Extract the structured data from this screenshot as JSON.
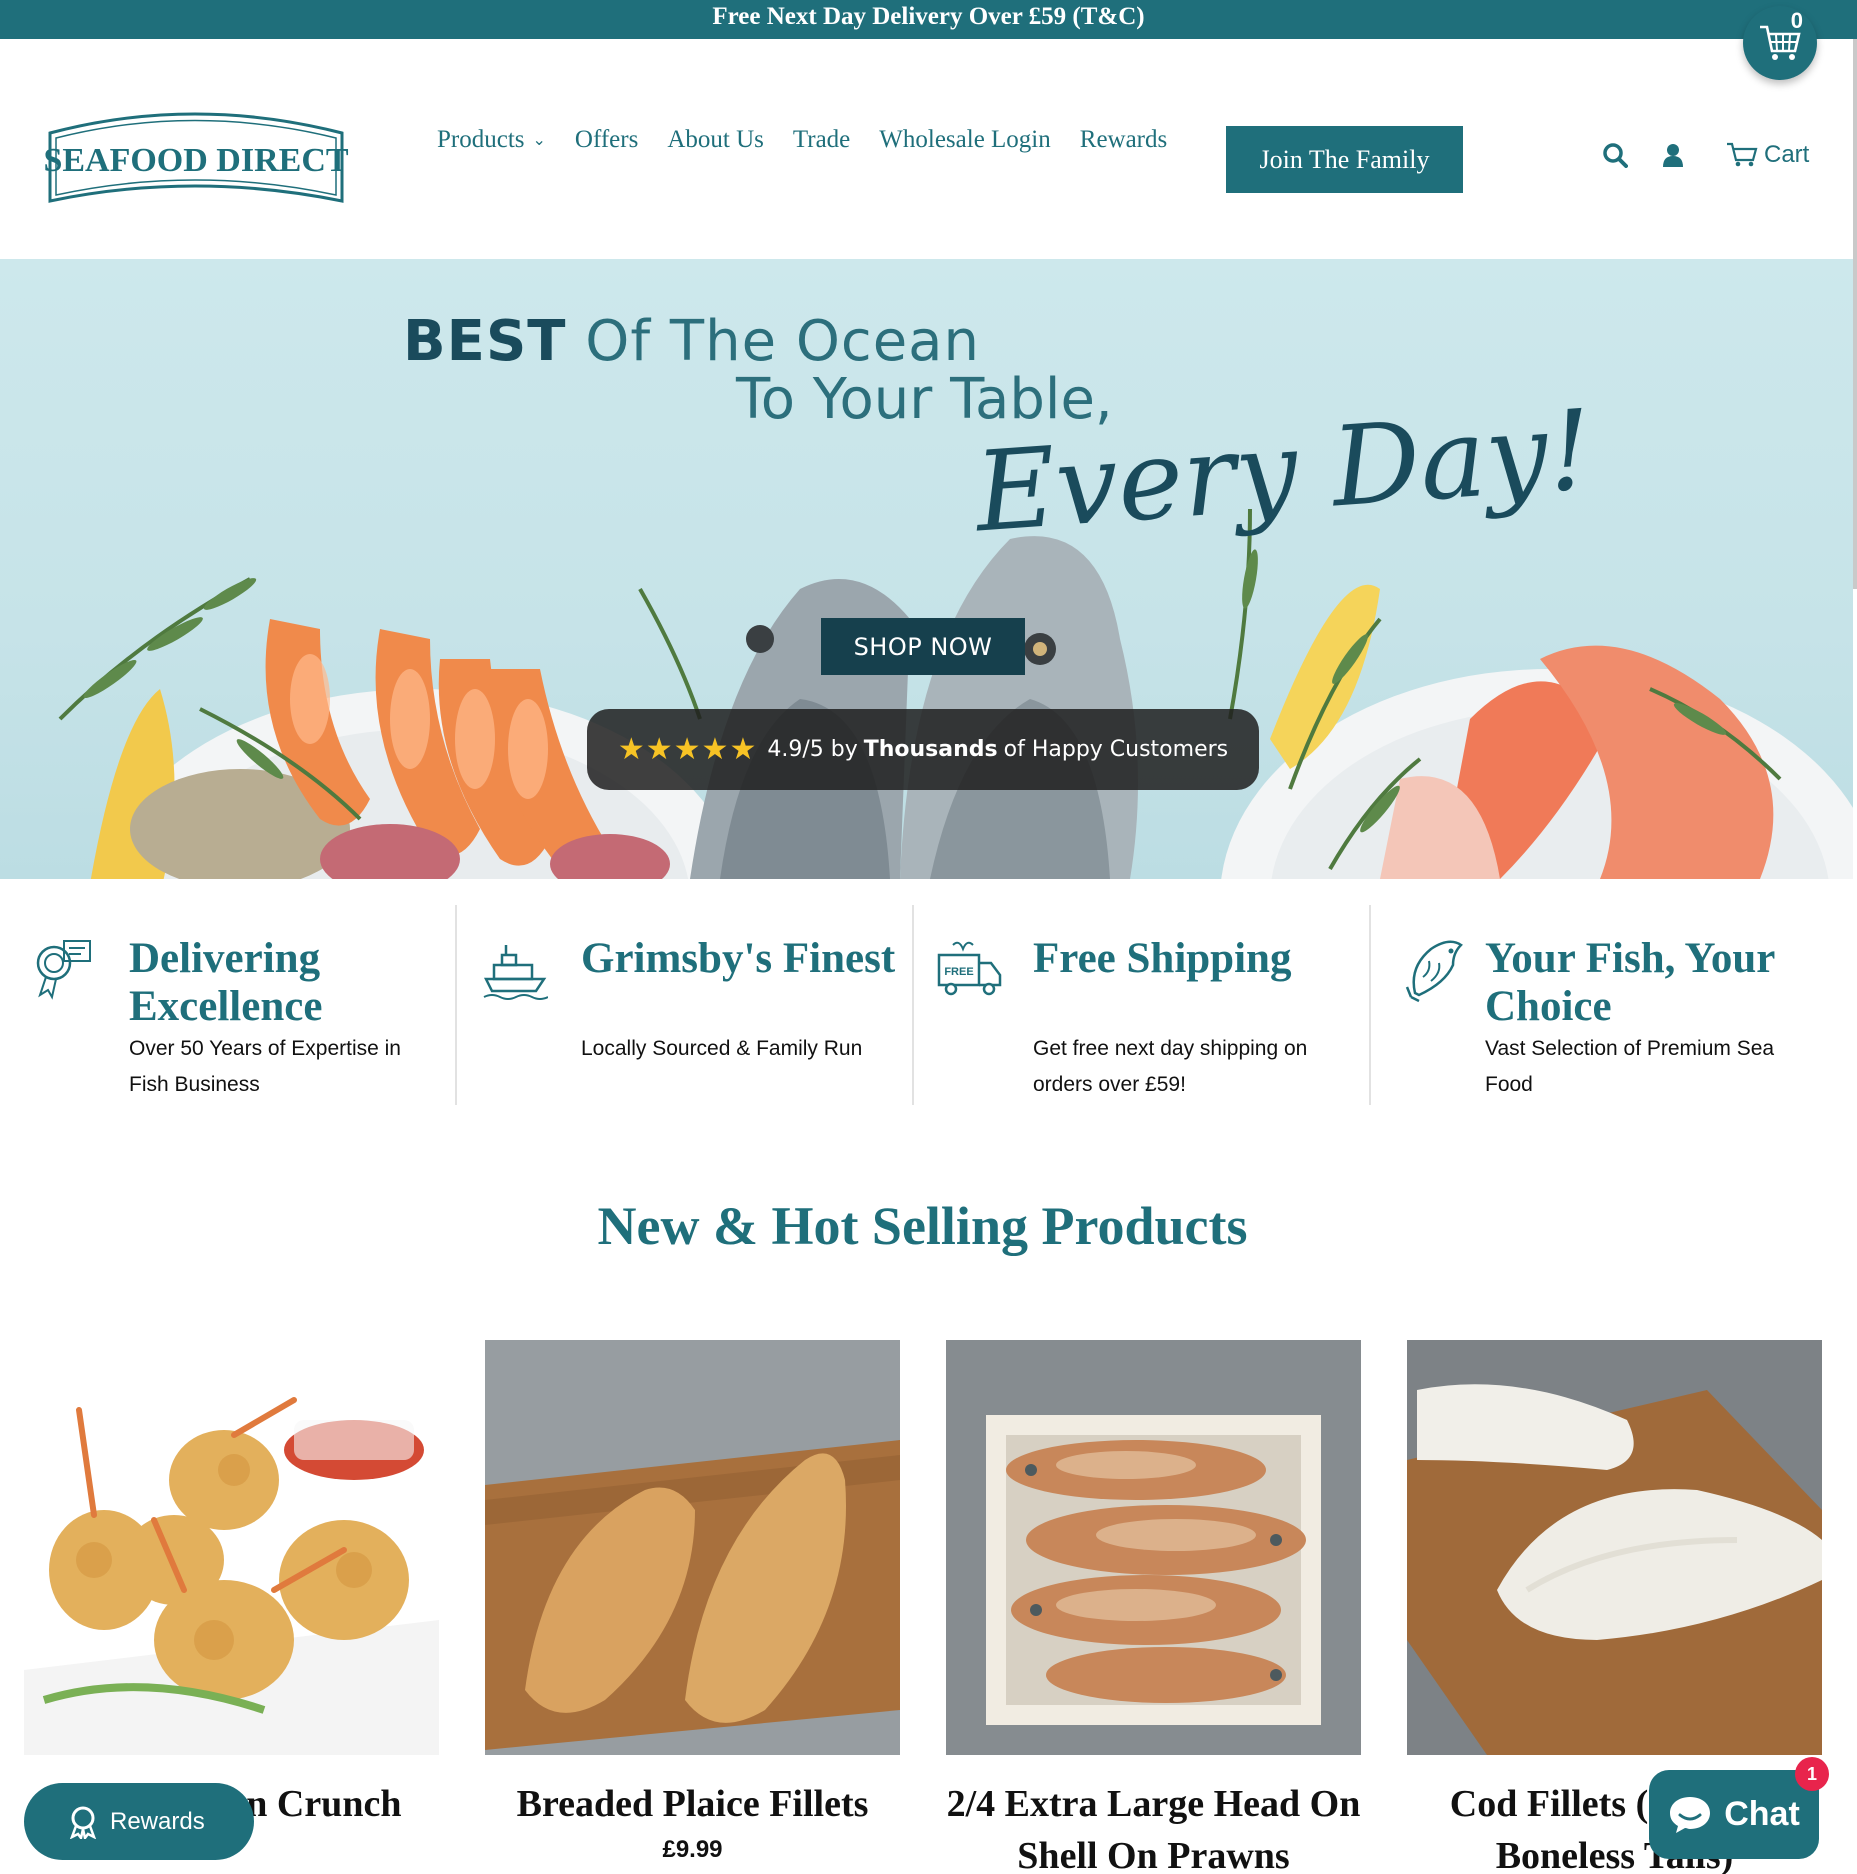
{
  "announcement": {
    "text": "Free Next Day Delivery Over £59 (T&C)"
  },
  "cart_bubble": {
    "count": "0",
    "icon": "basket-icon"
  },
  "logo": {
    "text": "SEAFOOD DIRECT"
  },
  "nav": {
    "items": [
      {
        "label": "Products",
        "has_dropdown": true
      },
      {
        "label": "Offers"
      },
      {
        "label": "About Us"
      },
      {
        "label": "Trade"
      },
      {
        "label": "Wholesale Login"
      },
      {
        "label": "Rewards"
      }
    ],
    "cta": "Join The Family",
    "cart_label": "Cart"
  },
  "hero": {
    "line1_bold": "BEST",
    "line1_rest": "Of The Ocean",
    "line2": "To Your Table,",
    "script": "Every Day!",
    "button": "SHOP NOW",
    "rating_stars": "★★★★★",
    "rating_score": "4.9/5 by",
    "rating_bold": "Thousands",
    "rating_rest": "of Happy Customers"
  },
  "features": [
    {
      "icon": "award-certificate-icon",
      "title": "Delivering Excellence",
      "desc": "Over 50 Years of Expertise in Fish Business"
    },
    {
      "icon": "ship-icon",
      "title": "Grimsby's Finest",
      "desc": "Locally Sourced & Family Run"
    },
    {
      "icon": "free-delivery-truck-icon",
      "title": "Free Shipping",
      "desc": "Get free next day shipping on orders over £59!"
    },
    {
      "icon": "fish-icon",
      "title": "Your Fish, Your Choice",
      "desc": "Vast Selection of Premium Sea Food"
    }
  ],
  "section_title": "New & Hot Selling Products",
  "products": [
    {
      "name": "Sizzling Prawn Crunch",
      "visible_name": "…ing Prawn Crunch"
    },
    {
      "name": "Breaded Plaice Fillets",
      "price": "£9.99"
    },
    {
      "name": "2/4 Extra Large Head On Shell On Prawns"
    },
    {
      "name": "Cod Fillets (Skinless Boneless Tails)"
    }
  ],
  "widgets": {
    "rewards_label": "Rewards",
    "chat_label": "Chat",
    "chat_badge": "1"
  },
  "colors": {
    "brand": "#1f6f7b",
    "dark": "#16404d",
    "badge": "#e8244c",
    "star": "#f7c325"
  }
}
